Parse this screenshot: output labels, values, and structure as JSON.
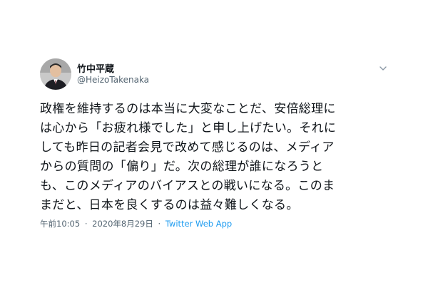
{
  "tweet": {
    "author": {
      "display_name": "竹中平蔵",
      "handle": "@HeizoTakenaka"
    },
    "menu_icon": "chevron-down-icon",
    "text_lines": [
      "政権を維持するのは本当に大変なことだ、安倍総理に",
      "は心から「お疲れ様でした」と申し上げたい。それに",
      "しても昨日の記者会見で改めて感じるのは、メディア",
      "からの質問の「偏り」だ。次の総理が誰になろうと",
      "も、このメディアのバイアスとの戦いになる。このま",
      "まだと、日本を良くするのは益々難しくなる。"
    ],
    "time": "午前10:05",
    "date": "2020年8月29日",
    "separator": "·",
    "source": "Twitter Web App"
  },
  "colors": {
    "text": "#0f1419",
    "secondary": "#536471",
    "link": "#1d9bf0"
  }
}
